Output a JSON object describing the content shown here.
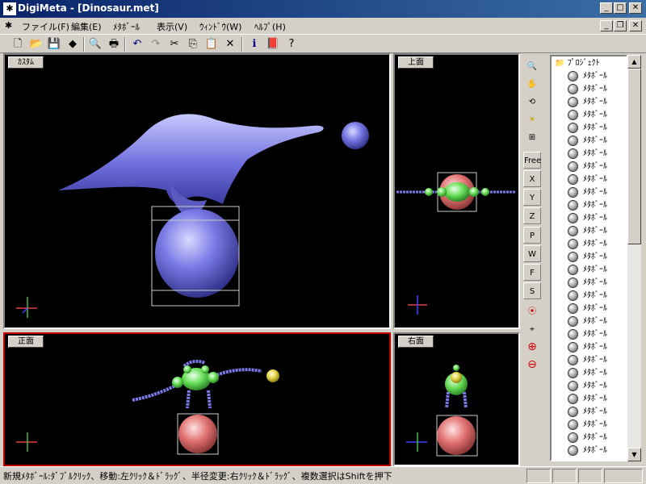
{
  "window": {
    "title": "DigiMeta - [Dinosaur.met]",
    "app_icon": "digimeta-icon"
  },
  "menu": [
    "ファイル(F)",
    "編集(E)",
    "ﾒﾀﾎﾞｰﾙ",
    "表示(V)",
    "ｳｨﾝﾄﾞｳ(W)",
    "ﾍﾙﾌﾟ(H)"
  ],
  "viewports": {
    "custom": {
      "label": "ｶｽﾀﾑ"
    },
    "top": {
      "label": "上面"
    },
    "front": {
      "label": "正面"
    },
    "right": {
      "label": "右面"
    }
  },
  "tools": {
    "free": "Free",
    "x": "X",
    "y": "Y",
    "z": "Z",
    "p": "P",
    "w": "W",
    "f": "F",
    "s": "S"
  },
  "tree": {
    "root": "ﾌﾟﾛｼﾞｪｸﾄ",
    "items": [
      "ﾒﾀﾎﾞｰﾙ",
      "ﾒﾀﾎﾞｰﾙ",
      "ﾒﾀﾎﾞｰﾙ",
      "ﾒﾀﾎﾞｰﾙ",
      "ﾒﾀﾎﾞｰﾙ",
      "ﾒﾀﾎﾞｰﾙ",
      "ﾒﾀﾎﾞｰﾙ",
      "ﾒﾀﾎﾞｰﾙ",
      "ﾒﾀﾎﾞｰﾙ",
      "ﾒﾀﾎﾞｰﾙ",
      "ﾒﾀﾎﾞｰﾙ",
      "ﾒﾀﾎﾞｰﾙ",
      "ﾒﾀﾎﾞｰﾙ",
      "ﾒﾀﾎﾞｰﾙ",
      "ﾒﾀﾎﾞｰﾙ",
      "ﾒﾀﾎﾞｰﾙ",
      "ﾒﾀﾎﾞｰﾙ",
      "ﾒﾀﾎﾞｰﾙ",
      "ﾒﾀﾎﾞｰﾙ",
      "ﾒﾀﾎﾞｰﾙ",
      "ﾒﾀﾎﾞｰﾙ",
      "ﾒﾀﾎﾞｰﾙ",
      "ﾒﾀﾎﾞｰﾙ",
      "ﾒﾀﾎﾞｰﾙ",
      "ﾒﾀﾎﾞｰﾙ",
      "ﾒﾀﾎﾞｰﾙ",
      "ﾒﾀﾎﾞｰﾙ",
      "ﾒﾀﾎﾞｰﾙ",
      "ﾒﾀﾎﾞｰﾙ",
      "ﾒﾀﾎﾞｰﾙ"
    ]
  },
  "status": "新規ﾒﾀﾎﾞｰﾙ:ﾀﾞﾌﾞﾙｸﾘｯｸ、移動:左ｸﾘｯｸ＆ﾄﾞﾗｯｸﾞ、半径変更:右ｸﾘｯｸ＆ﾄﾞﾗｯｸﾞ、複数選択はShiftを押下",
  "colors": {
    "title_bar": "#0a246a",
    "metaball_blue": "#7a7ae6",
    "metaball_green": "#66dd55",
    "selected_red": "#e07070",
    "active_border": "#c00000"
  }
}
